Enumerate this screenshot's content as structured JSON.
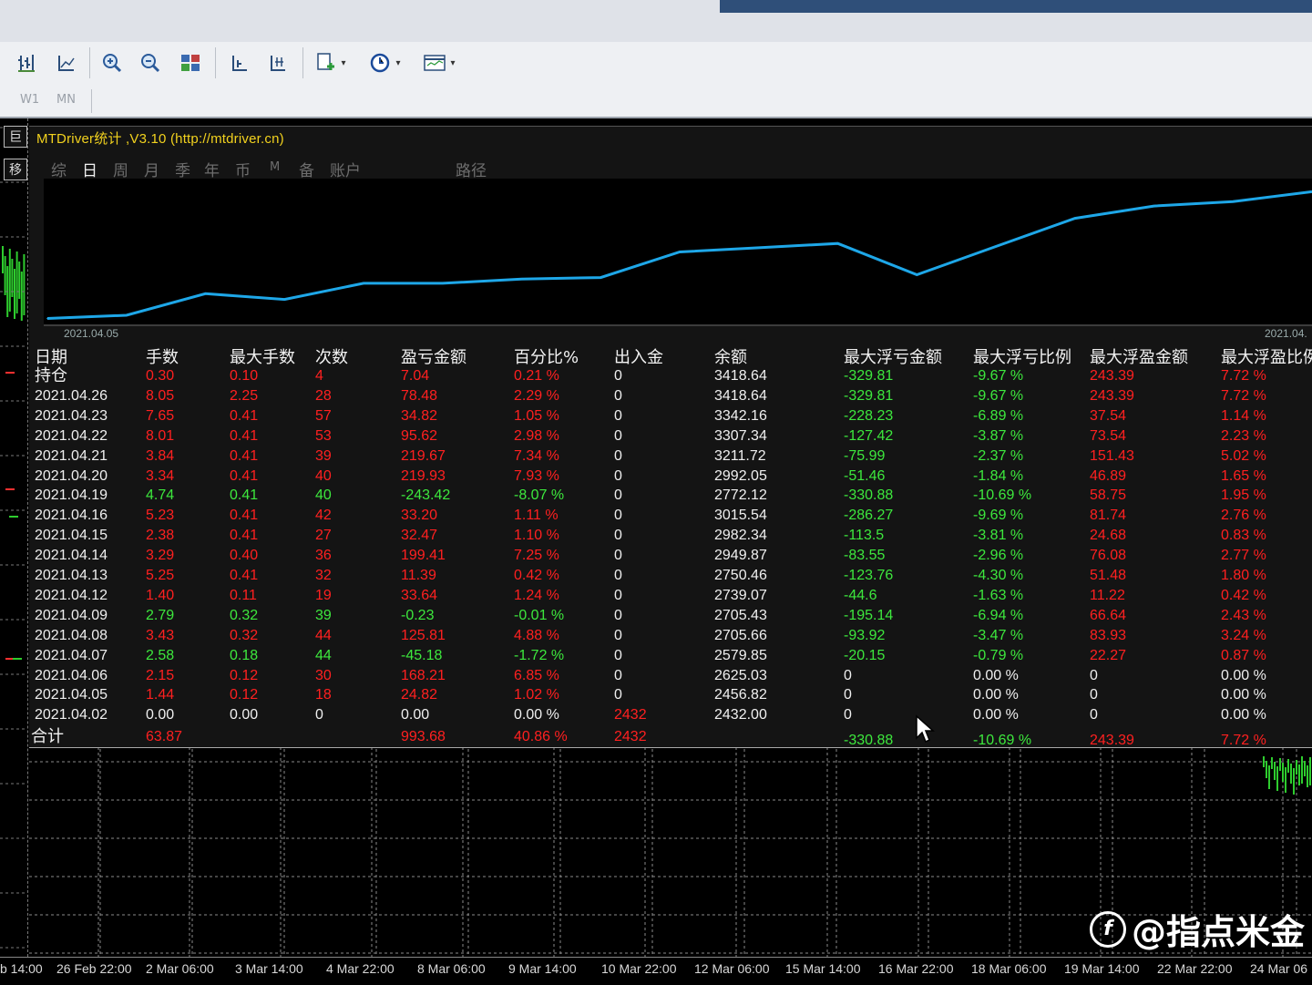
{
  "toolbar": {
    "icons": [
      "bar-chart-icon",
      "line-chart-icon",
      "zoom-in-icon",
      "zoom-out-icon",
      "tile-windows-icon",
      "auto-scroll-icon",
      "chart-shift-icon",
      "add-indicator-icon",
      "clock-periods-icon",
      "templates-icon"
    ]
  },
  "timeframes": [
    "W1",
    "MN"
  ],
  "panel": {
    "title": "MTDriver统计 ,V3.10 (http://mtdriver.cn)",
    "tabs": [
      {
        "label": "综",
        "active": false
      },
      {
        "label": "日",
        "active": true
      },
      {
        "label": "周",
        "active": false
      },
      {
        "label": "月",
        "active": false
      },
      {
        "label": "季",
        "active": false
      },
      {
        "label": "年",
        "active": false
      },
      {
        "label": "币",
        "active": false
      },
      {
        "label": "M",
        "active": false
      },
      {
        "label": "备",
        "active": false
      },
      {
        "label": "账户",
        "active": false
      },
      {
        "label": "路径",
        "active": false
      }
    ],
    "left_buttons": [
      "巨",
      "移"
    ]
  },
  "chart_data": {
    "type": "line",
    "title": "",
    "x_start_label": "2021.04.05",
    "x_end_label": "2021.04.",
    "x": [
      "2021.04.02",
      "2021.04.05",
      "2021.04.06",
      "2021.04.07",
      "2021.04.08",
      "2021.04.09",
      "2021.04.12",
      "2021.04.13",
      "2021.04.14",
      "2021.04.15",
      "2021.04.16",
      "2021.04.19",
      "2021.04.20",
      "2021.04.21",
      "2021.04.22",
      "2021.04.23",
      "2021.04.26"
    ],
    "values": [
      2432.0,
      2456.82,
      2625.03,
      2579.85,
      2705.66,
      2705.43,
      2739.07,
      2750.46,
      2949.87,
      2982.34,
      3015.54,
      2772.12,
      2992.05,
      3211.72,
      3307.34,
      3342.16,
      3418.64
    ],
    "color": "#1ea7e8"
  },
  "table": {
    "headers": [
      "日期",
      "手数",
      "最大手数",
      "次数",
      "盈亏金额",
      "百分比%",
      "出入金",
      "余额",
      "最大浮亏金额",
      "最大浮亏比例",
      "最大浮盈金额",
      "最大浮盈比例"
    ],
    "rows": [
      {
        "c": [
          "持仓",
          "0.30",
          "0.10",
          "4",
          "7.04",
          "0.21 %",
          "0",
          "3418.64",
          "-329.81",
          "-9.67 %",
          "243.39",
          "7.72 %"
        ],
        "s": "r"
      },
      {
        "c": [
          "2021.04.26",
          "8.05",
          "2.25",
          "28",
          "78.48",
          "2.29 %",
          "0",
          "3418.64",
          "-329.81",
          "-9.67 %",
          "243.39",
          "7.72 %"
        ],
        "s": "r"
      },
      {
        "c": [
          "2021.04.23",
          "7.65",
          "0.41",
          "57",
          "34.82",
          "1.05 %",
          "0",
          "3342.16",
          "-228.23",
          "-6.89 %",
          "37.54",
          "1.14 %"
        ],
        "s": "r"
      },
      {
        "c": [
          "2021.04.22",
          "8.01",
          "0.41",
          "53",
          "95.62",
          "2.98 %",
          "0",
          "3307.34",
          "-127.42",
          "-3.87 %",
          "73.54",
          "2.23 %"
        ],
        "s": "r"
      },
      {
        "c": [
          "2021.04.21",
          "3.84",
          "0.41",
          "39",
          "219.67",
          "7.34 %",
          "0",
          "3211.72",
          "-75.99",
          "-2.37 %",
          "151.43",
          "5.02 %"
        ],
        "s": "r"
      },
      {
        "c": [
          "2021.04.20",
          "3.34",
          "0.41",
          "40",
          "219.93",
          "7.93 %",
          "0",
          "2992.05",
          "-51.46",
          "-1.84 %",
          "46.89",
          "1.65 %"
        ],
        "s": "r"
      },
      {
        "c": [
          "2021.04.19",
          "4.74",
          "0.41",
          "40",
          "-243.42",
          "-8.07 %",
          "0",
          "2772.12",
          "-330.88",
          "-10.69 %",
          "58.75",
          "1.95 %"
        ],
        "s": "g"
      },
      {
        "c": [
          "2021.04.16",
          "5.23",
          "0.41",
          "42",
          "33.20",
          "1.11 %",
          "0",
          "3015.54",
          "-286.27",
          "-9.69 %",
          "81.74",
          "2.76 %"
        ],
        "s": "r"
      },
      {
        "c": [
          "2021.04.15",
          "2.38",
          "0.41",
          "27",
          "32.47",
          "1.10 %",
          "0",
          "2982.34",
          "-113.5",
          "-3.81 %",
          "24.68",
          "0.83 %"
        ],
        "s": "r"
      },
      {
        "c": [
          "2021.04.14",
          "3.29",
          "0.40",
          "36",
          "199.41",
          "7.25 %",
          "0",
          "2949.87",
          "-83.55",
          "-2.96 %",
          "76.08",
          "2.77 %"
        ],
        "s": "r"
      },
      {
        "c": [
          "2021.04.13",
          "5.25",
          "0.41",
          "32",
          "11.39",
          "0.42 %",
          "0",
          "2750.46",
          "-123.76",
          "-4.30 %",
          "51.48",
          "1.80 %"
        ],
        "s": "r"
      },
      {
        "c": [
          "2021.04.12",
          "1.40",
          "0.11",
          "19",
          "33.64",
          "1.24 %",
          "0",
          "2739.07",
          "-44.6",
          "-1.63 %",
          "11.22",
          "0.42 %"
        ],
        "s": "r"
      },
      {
        "c": [
          "2021.04.09",
          "2.79",
          "0.32",
          "39",
          "-0.23",
          "-0.01 %",
          "0",
          "2705.43",
          "-195.14",
          "-6.94 %",
          "66.64",
          "2.43 %"
        ],
        "s": "g"
      },
      {
        "c": [
          "2021.04.08",
          "3.43",
          "0.32",
          "44",
          "125.81",
          "4.88 %",
          "0",
          "2705.66",
          "-93.92",
          "-3.47 %",
          "83.93",
          "3.24 %"
        ],
        "s": "r"
      },
      {
        "c": [
          "2021.04.07",
          "2.58",
          "0.18",
          "44",
          "-45.18",
          "-1.72 %",
          "0",
          "2579.85",
          "-20.15",
          "-0.79 %",
          "22.27",
          "0.87 %"
        ],
        "s": "g"
      },
      {
        "c": [
          "2021.04.06",
          "2.15",
          "0.12",
          "30",
          "168.21",
          "6.85 %",
          "0",
          "2625.03",
          "0",
          "0.00 %",
          "0",
          "0.00 %"
        ],
        "s": "r"
      },
      {
        "c": [
          "2021.04.05",
          "1.44",
          "0.12",
          "18",
          "24.82",
          "1.02 %",
          "0",
          "2456.82",
          "0",
          "0.00 %",
          "0",
          "0.00 %"
        ],
        "s": "r"
      },
      {
        "c": [
          "2021.04.02",
          "0.00",
          "0.00",
          "0",
          "0.00",
          "0.00 %",
          "2432",
          "2432.00",
          "0",
          "0.00 %",
          "0",
          "0.00 %"
        ],
        "s": "w"
      }
    ],
    "total": {
      "c": [
        "合计",
        "63.87",
        "",
        "",
        "993.68",
        "40.86 %",
        "2432",
        "",
        "-330.88",
        "-10.69 %",
        "243.39",
        "7.72 %"
      ]
    }
  },
  "bottom_axis": [
    "b 14:00",
    "26 Feb 22:00",
    "2 Mar 06:00",
    "3 Mar 14:00",
    "4 Mar 22:00",
    "8 Mar 06:00",
    "9 Mar 14:00",
    "10 Mar 22:00",
    "12 Mar 06:00",
    "15 Mar 14:00",
    "16 Mar 22:00",
    "18 Mar 06:00",
    "19 Mar 14:00",
    "22 Mar 22:00",
    "24 Mar 06"
  ],
  "watermark": {
    "text": "@指点米金"
  },
  "colors": {
    "profit": "#ff2020",
    "loss": "#3de83d",
    "text": "#f0f0f0",
    "title": "#f2d21e",
    "equity": "#1ea7e8"
  }
}
